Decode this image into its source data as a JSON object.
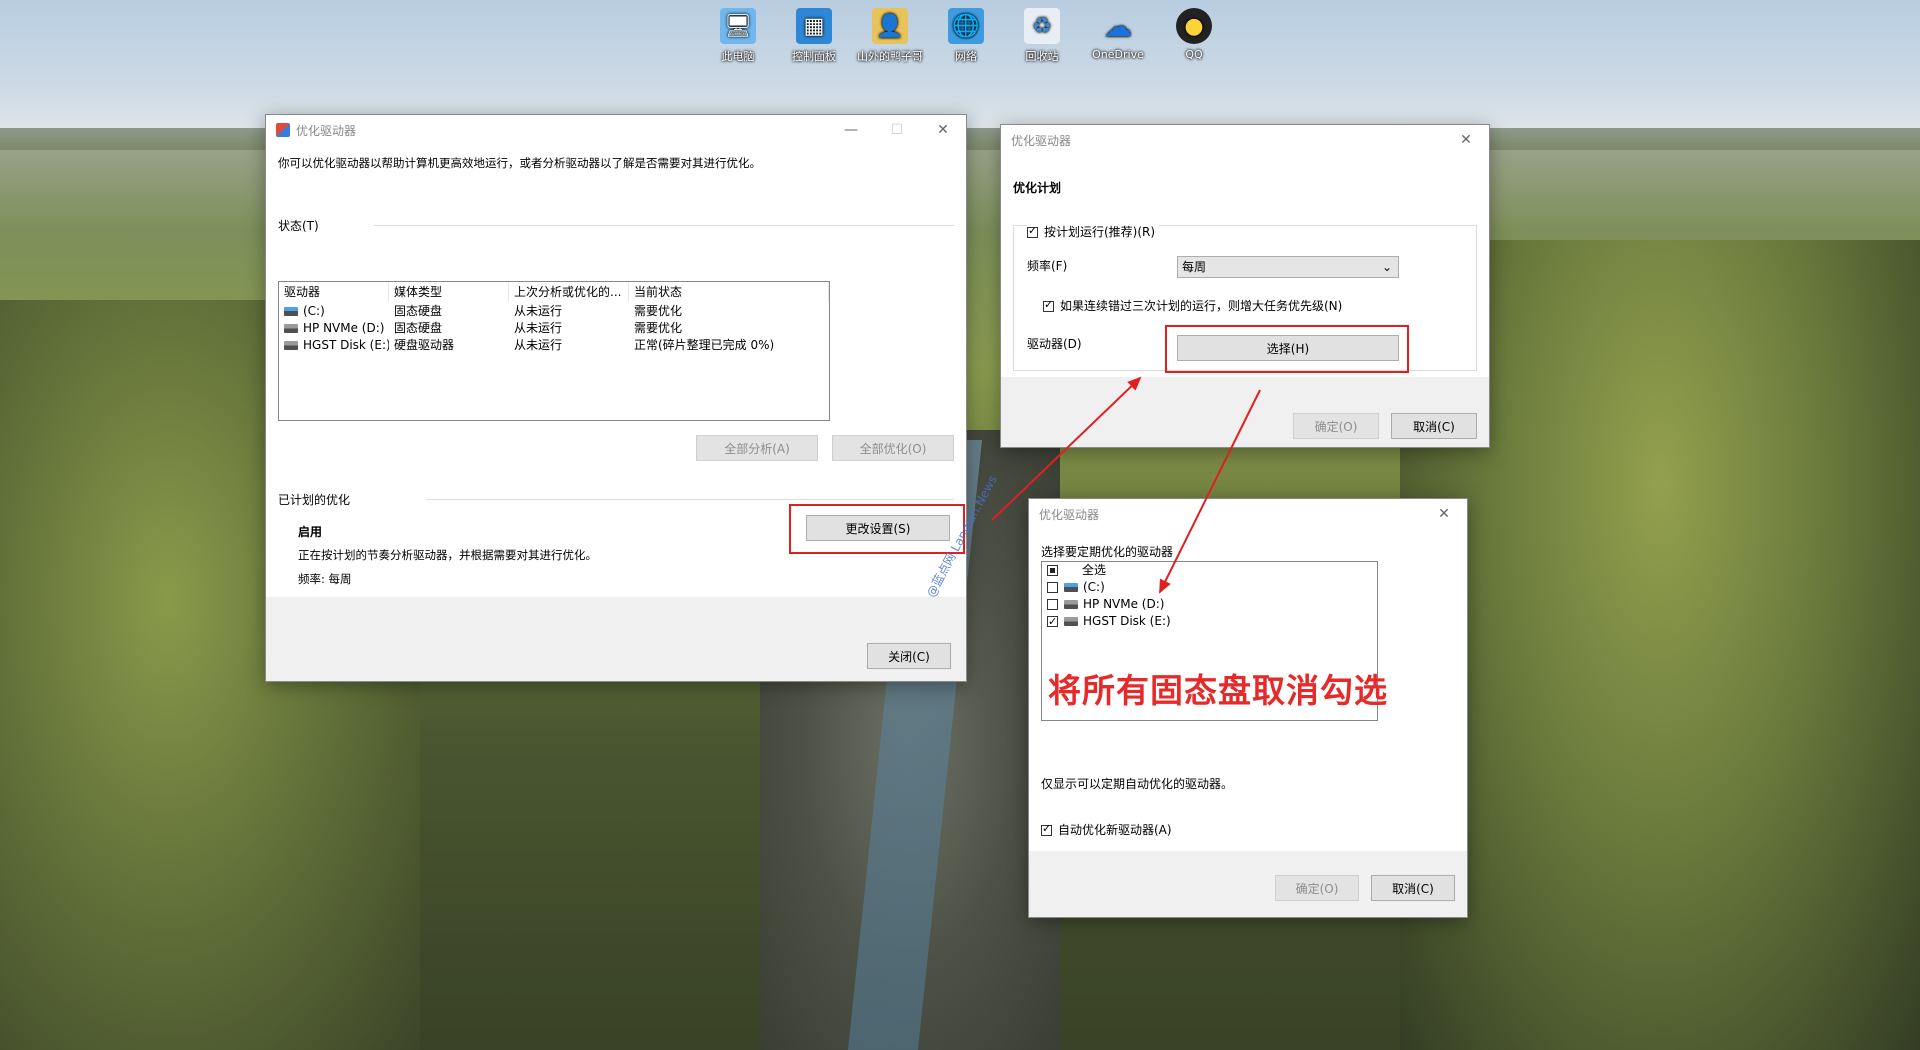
{
  "desktop": {
    "icons": [
      {
        "label": "此电脑",
        "icon": "computer-icon"
      },
      {
        "label": "控制面板",
        "icon": "control-panel-icon"
      },
      {
        "label": "山外的鸭子哥",
        "icon": "user-folder-icon"
      },
      {
        "label": "网络",
        "icon": "network-icon"
      },
      {
        "label": "回收站",
        "icon": "recycle-bin-icon"
      },
      {
        "label": "OneDrive",
        "icon": "onedrive-icon"
      },
      {
        "label": "QQ",
        "icon": "qq-icon"
      }
    ]
  },
  "main_window": {
    "title": "优化驱动器",
    "description": "你可以优化驱动器以帮助计算机更高效地运行，或者分析驱动器以了解是否需要对其进行优化。",
    "status_label": "状态(T)",
    "columns": [
      "驱动器",
      "媒体类型",
      "上次分析或优化的...",
      "当前状态"
    ],
    "rows": [
      {
        "drive": "(C:)",
        "media": "固态硬盘",
        "last": "从未运行",
        "status": "需要优化",
        "icon": "system-drive-icon"
      },
      {
        "drive": "HP NVMe (D:)",
        "media": "固态硬盘",
        "last": "从未运行",
        "status": "需要优化",
        "icon": "drive-icon"
      },
      {
        "drive": "HGST Disk (E:)",
        "media": "硬盘驱动器",
        "last": "从未运行",
        "status": "正常(碎片整理已完成 0%)",
        "icon": "drive-icon"
      }
    ],
    "analyze_all": "全部分析(A)",
    "optimize_all": "全部优化(O)",
    "scheduled_label": "已计划的优化",
    "scheduled_state": "启用",
    "scheduled_desc": "正在按计划的节奏分析驱动器，并根据需要对其进行优化。",
    "frequency_text": "频率: 每周",
    "change_settings": "更改设置(S)",
    "close": "关闭(C)"
  },
  "schedule_window": {
    "title": "优化驱动器",
    "heading": "优化计划",
    "run_on_schedule": "按计划运行(推荐)(R)",
    "frequency_label": "频率(F)",
    "frequency_value": "每周",
    "increase_priority": "如果连续错过三次计划的运行，则增大任务优先级(N)",
    "drives_label": "驱动器(D)",
    "choose": "选择(H)",
    "ok": "确定(O)",
    "cancel": "取消(C)"
  },
  "select_window": {
    "title": "优化驱动器",
    "prompt": "选择要定期优化的驱动器",
    "items": [
      {
        "label": "全选",
        "state": "indeterminate"
      },
      {
        "label": "(C:)",
        "state": "unchecked",
        "icon": "system-drive-icon"
      },
      {
        "label": "HP NVMe (D:)",
        "state": "unchecked",
        "icon": "drive-icon"
      },
      {
        "label": "HGST Disk (E:)",
        "state": "checked",
        "icon": "drive-icon"
      }
    ],
    "note": "仅显示可以定期自动优化的驱动器。",
    "auto_new": "自动优化新驱动器(A)",
    "ok": "确定(O)",
    "cancel": "取消(C)"
  },
  "annotation": "将所有固态盘取消勾选",
  "watermark": "@蓝点网 Landian.News",
  "colors": {
    "highlight": "#e02020"
  }
}
